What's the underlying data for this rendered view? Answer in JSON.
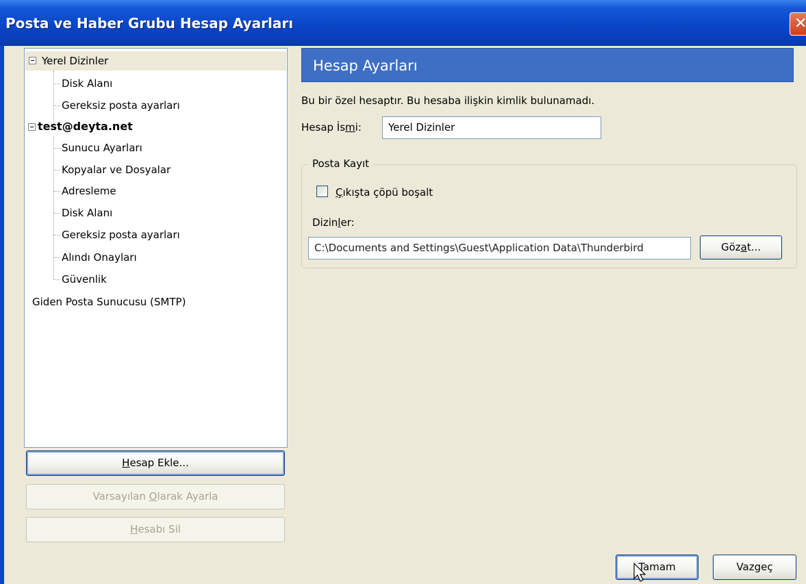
{
  "window": {
    "title": "Posta ve Haber Grubu Hesap Ayarları",
    "close_glyph": "✕"
  },
  "tree": {
    "items": [
      {
        "label": "Yerel Dizinler"
      },
      {
        "label": "Disk Alanı"
      },
      {
        "label": "Gereksiz posta ayarları"
      },
      {
        "label": "test@deyta.net"
      },
      {
        "label": "Sunucu Ayarları"
      },
      {
        "label": "Kopyalar ve Dosyalar"
      },
      {
        "label": "Adresleme"
      },
      {
        "label": "Disk Alanı"
      },
      {
        "label": "Gereksiz posta ayarları"
      },
      {
        "label": "Alındı Onayları"
      },
      {
        "label": "Güvenlik"
      },
      {
        "label": "Giden Posta Sunucusu (SMTP)"
      }
    ]
  },
  "left_buttons": {
    "add_account": {
      "pre": "",
      "ul": "H",
      "post": "esap Ekle..."
    },
    "set_default": {
      "pre": "Varsayılan ",
      "ul": "O",
      "post": "larak Ayarla"
    },
    "remove_account": {
      "pre": "",
      "ul": "H",
      "post": "esabı Sil"
    }
  },
  "panel": {
    "header": "Hesap Ayarları",
    "info": "Bu bir özel hesaptır. Bu hesaba ilişkin kimlik bulunamadı.",
    "account_name_label": {
      "pre": "Hesap İs",
      "ul": "m",
      "post": "i:"
    },
    "account_name_value": "Yerel Dizinler",
    "group_title": "Posta Kayıt",
    "empty_trash_label": {
      "pre": "",
      "ul": "Ç",
      "post": "ıkışta çöpü boşalt"
    },
    "empty_trash_checked": false,
    "directory_label": {
      "pre": "Dizin",
      "ul": "l",
      "post": "er:"
    },
    "directory_value": "C:\\Documents and Settings\\Guest\\Application Data\\Thunderbird",
    "browse_button": {
      "pre": "Göz",
      "ul": "a",
      "post": "t..."
    }
  },
  "footer": {
    "ok_label": "Tamam",
    "cancel_label": "Vazgeç"
  },
  "colors": {
    "titlebar": "#0a46c8",
    "header_bar": "#3e6fc4",
    "dialog_bg": "#ece9d8"
  }
}
